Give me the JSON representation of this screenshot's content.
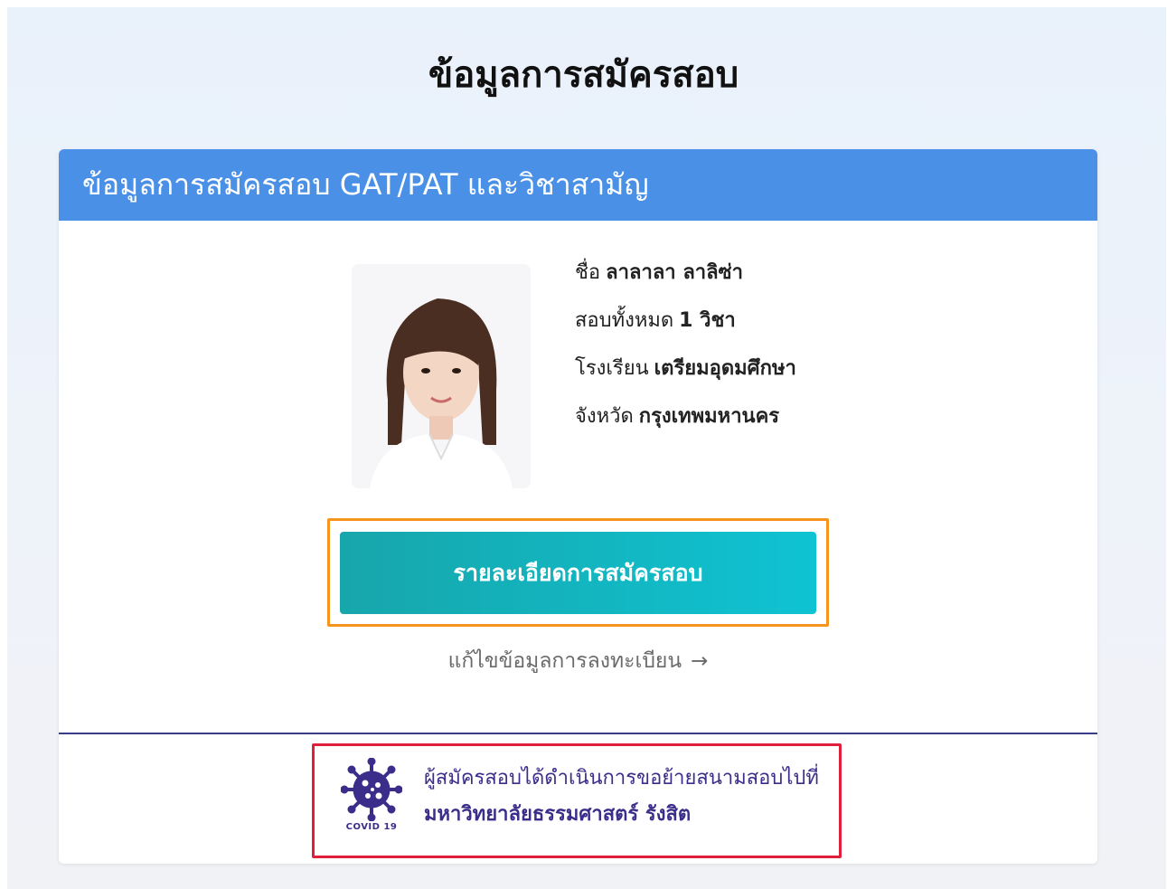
{
  "page": {
    "title": "ข้อมูลการสมัครสอบ"
  },
  "card": {
    "header": "ข้อมูลการสมัครสอบ GAT/PAT และวิชาสามัญ",
    "applicant": {
      "name_label": "ชื่อ",
      "name": "ลาลาลา ลาลิซ่า",
      "subjects_label": "สอบทั้งหมด",
      "subjects": "1 วิชา",
      "school_label": "โรงเรียน",
      "school": "เตรียมอุดมศึกษา",
      "province_label": "จังหวัด",
      "province": "กรุงเทพมหานคร"
    },
    "detail_button": "รายละเอียดการสมัครสอบ",
    "edit_link": "แก้ไขข้อมูลการลงทะเบียน",
    "edit_arrow": "→"
  },
  "notice": {
    "icon": "covid-virus-icon",
    "icon_label": "COVID 19",
    "line1": "ผู้สมัครสอบได้ดำเนินการขอย้ายสนามสอบไปที่",
    "line2": "มหาวิทยาลัยธรรมศาสตร์ รังสิต"
  },
  "colors": {
    "header_blue": "#4a90e6",
    "button_teal": "#17a6ab",
    "highlight_orange": "#f7941d",
    "highlight_red": "#e0203a",
    "notice_purple": "#3b2e8a"
  }
}
